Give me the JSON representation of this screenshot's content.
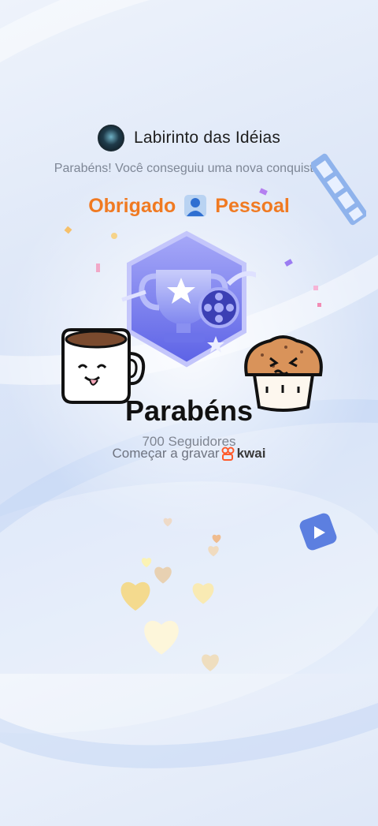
{
  "header": {
    "channel_name": "Labirinto das Idéias",
    "subtitle": "Parabéns! Você conseguiu uma nova conquista!"
  },
  "thanks": {
    "left_word": "Obrigado",
    "right_word": "Pessoal"
  },
  "achievement": {
    "title": "Parabéns",
    "followers": "700 Seguidores",
    "record_label": "Começar a gravar",
    "brand": "kwai"
  },
  "colors": {
    "accent_orange": "#f07a22",
    "badge_purple": "#7b7ef0",
    "background": "#dfe8f8"
  },
  "icons": [
    "channel-logo-icon",
    "person-icon",
    "trophy-badge-icon",
    "coffee-cup-sticker",
    "muffin-sticker",
    "film-strip-icon",
    "play-tile-icon",
    "kwai-logo-icon",
    "heart-icon"
  ]
}
